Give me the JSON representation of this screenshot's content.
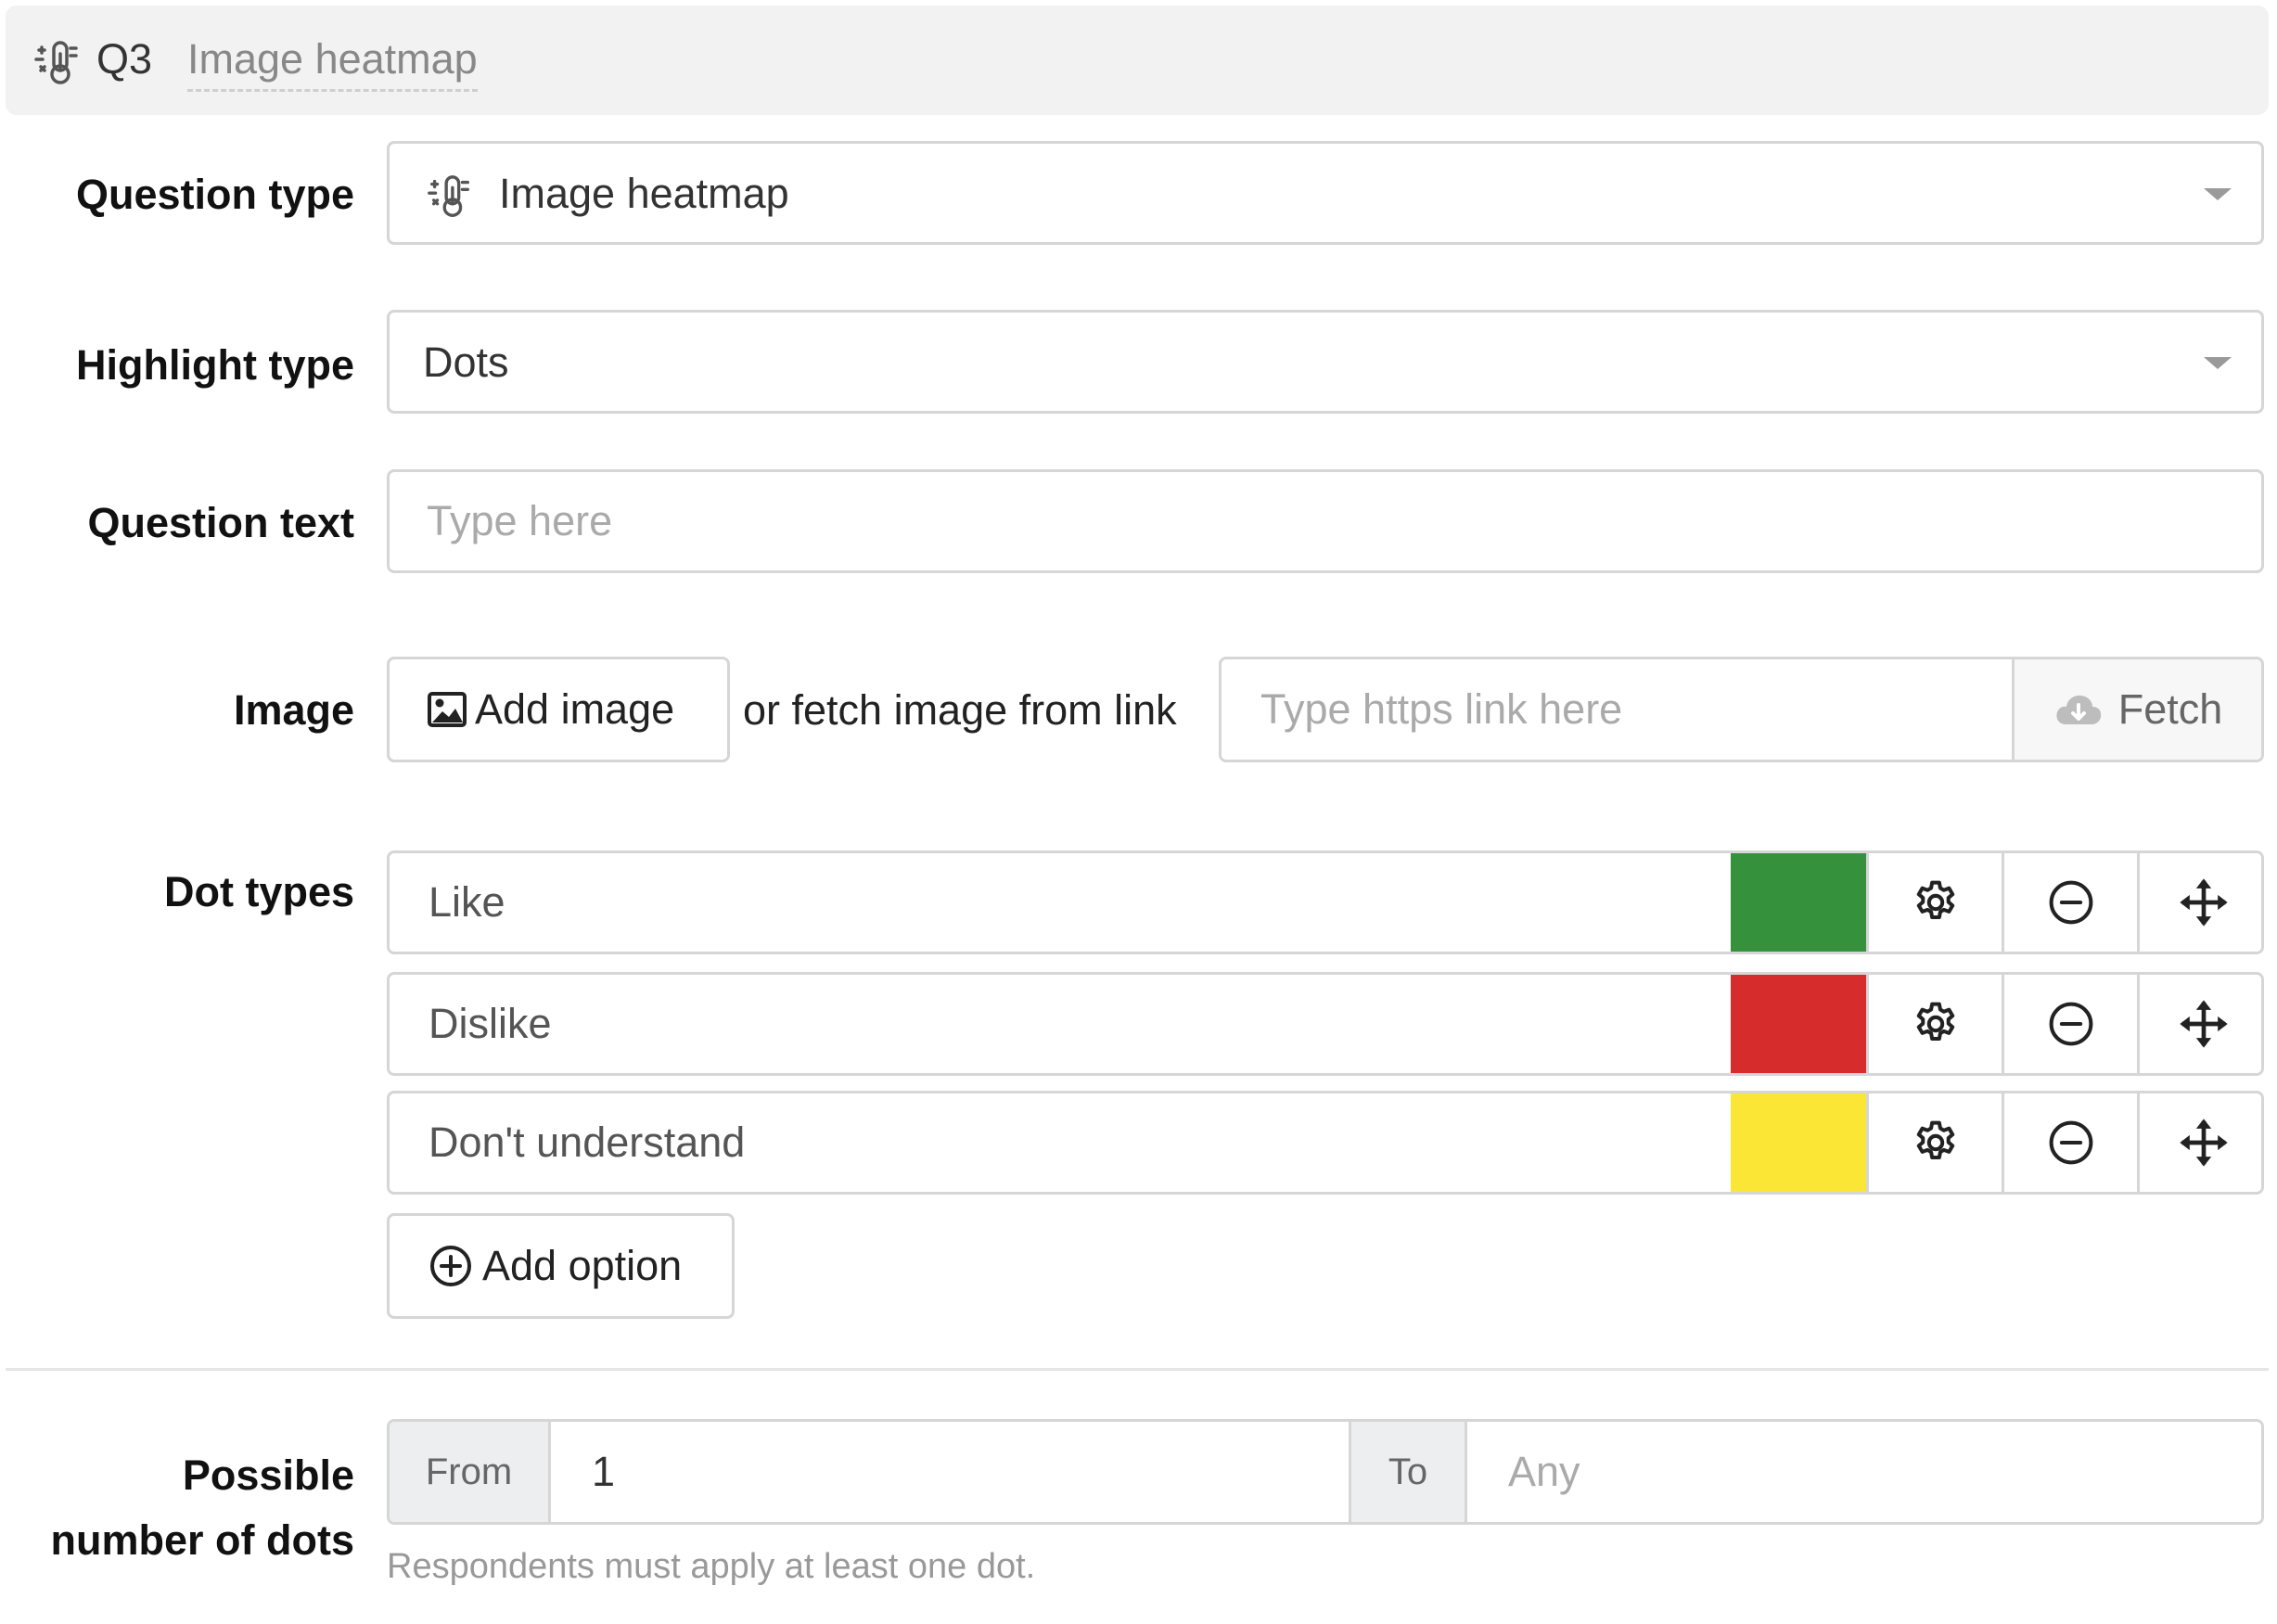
{
  "header": {
    "question_number": "Q3",
    "question_title": "Image heatmap",
    "icon": "heatmap-icon"
  },
  "question_type": {
    "label": "Question type",
    "value": "Image heatmap",
    "icon": "heatmap-icon"
  },
  "highlight_type": {
    "label": "Highlight type",
    "value": "Dots"
  },
  "question_text": {
    "label": "Question text",
    "placeholder": "Type here",
    "value": ""
  },
  "image": {
    "label": "Image",
    "add_button": "Add image",
    "or_text": "or fetch image from link",
    "link_placeholder": "Type https link here",
    "fetch_button": "Fetch"
  },
  "dot_types": {
    "label": "Dot types",
    "items": [
      {
        "name": "Like",
        "color": "#35913b"
      },
      {
        "name": "Dislike",
        "color": "#d62c2c"
      },
      {
        "name": "Don't understand",
        "color": "#fbe635"
      }
    ],
    "add_option": "Add option"
  },
  "possible_dots": {
    "label_line1": "Possible",
    "label_line2": "number of dots",
    "from_label": "From",
    "from_value": "1",
    "to_label": "To",
    "to_placeholder": "Any",
    "help": "Respondents must apply at least one dot."
  }
}
